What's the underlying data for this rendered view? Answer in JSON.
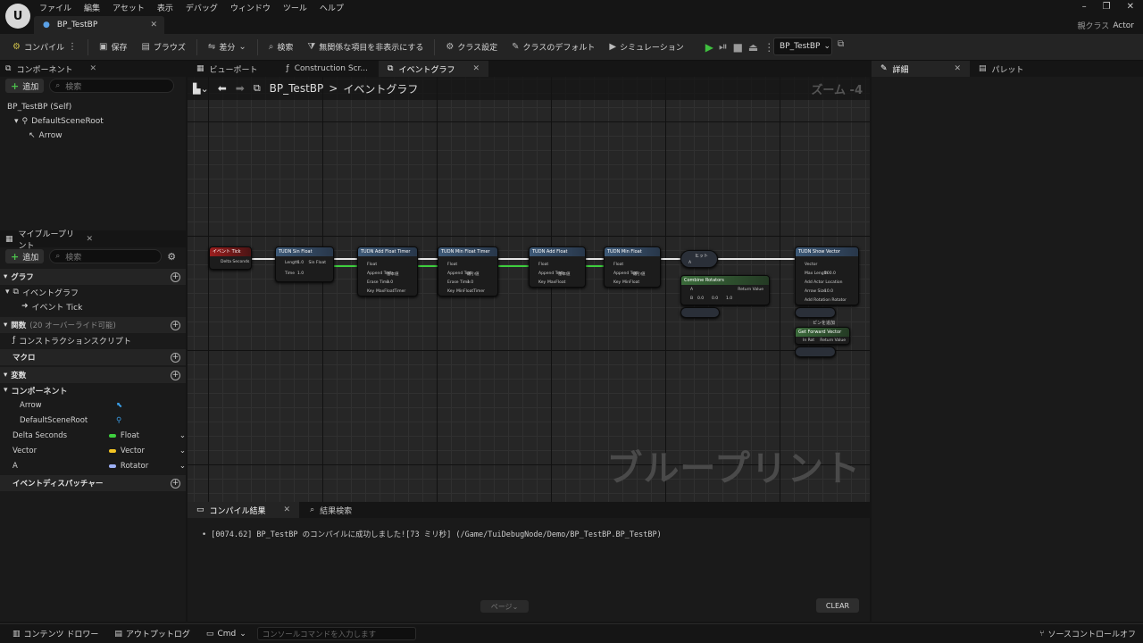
{
  "menu": [
    "ファイル",
    "編集",
    "アセット",
    "表示",
    "デバッグ",
    "ウィンドウ",
    "ツール",
    "ヘルプ"
  ],
  "doc_tab": "BP_TestBP",
  "parent_class": {
    "label": "親クラス",
    "value": "Actor"
  },
  "toolbar": {
    "compile": "コンパイル",
    "save": "保存",
    "browse": "ブラウズ",
    "diff": "差分",
    "find": "検索",
    "hide_unrelated": "無関係な項目を非表示にする",
    "class_settings": "クラス設定",
    "class_defaults": "クラスのデフォルト",
    "simulation": "シミュレーション",
    "debug_object": "BP_TestBP"
  },
  "components_panel": {
    "title": "コンポーネント",
    "add": "追加",
    "search_placeholder": "検索",
    "tree": [
      "BP_TestBP (Self)",
      "DefaultSceneRoot",
      "Arrow"
    ]
  },
  "my_blueprint": {
    "title": "マイブループリント",
    "add": "追加",
    "search_placeholder": "検索",
    "graphs": "グラフ",
    "event_graph": "イベントグラフ",
    "event_tick": "イベント Tick",
    "functions": "関数",
    "functions_sub": "(20 オーバーライド可能)",
    "construction_script": "コンストラクションスクリプト",
    "macros": "マクロ",
    "variables": "変数",
    "components": "コンポーネント",
    "comp_vars": [
      "Arrow",
      "DefaultSceneRoot"
    ],
    "vars": [
      {
        "name": "Delta Seconds",
        "type": "Float",
        "color": "#3ecf3e"
      },
      {
        "name": "Vector",
        "type": "Vector",
        "color": "#f3c423"
      },
      {
        "name": "A",
        "type": "Rotator",
        "color": "#9db0f5"
      }
    ],
    "dispatchers": "イベントディスパッチャー"
  },
  "graph_tabs": [
    "ビューポート",
    "Construction Scr...",
    "イベントグラフ"
  ],
  "graph": {
    "breadcrumb_bp": "BP_TestBP",
    "breadcrumb_sep": ">",
    "breadcrumb_graph": "イベントグラフ",
    "zoom": "ズーム -4",
    "watermark": "ブループリント"
  },
  "nodes": {
    "n1": {
      "title": "イベント Tick",
      "pin": "Delta Seconds"
    },
    "n2": {
      "title": "TUDN Sin Float",
      "pins": [
        "Length",
        "Time",
        "Sin Float"
      ],
      "vals": [
        "1.0",
        "1.0"
      ]
    },
    "n3": {
      "title": "TUDN Add Float Timer",
      "pins": [
        "Float",
        "Append Text",
        "Erase Time",
        "Key"
      ],
      "vals": [
        "基本値",
        "1.0",
        "MaxFloatTimer"
      ]
    },
    "n4": {
      "title": "TUDN Min Float Timer",
      "pins": [
        "Float",
        "Append Text",
        "Erase Time",
        "Key"
      ],
      "vals": [
        "最小値",
        "1.0",
        "MinFloatTimer"
      ]
    },
    "n5": {
      "title": "TUDN Add Float",
      "pins": [
        "Float",
        "Append Text",
        "Key"
      ],
      "vals": [
        "基本値",
        "MaxFloat"
      ]
    },
    "n6": {
      "title": "TUDN Min Float",
      "pins": [
        "Float",
        "Append Text",
        "Key"
      ],
      "vals": [
        "最小値",
        "MinFloat"
      ]
    },
    "n7": {
      "title": "ヒット",
      "pin": "A"
    },
    "n8": {
      "title": "Combine Rotators",
      "pins": [
        "A",
        "B",
        "Return Value"
      ],
      "vals": [
        "0.0",
        "0.0",
        "1.0"
      ]
    },
    "n9": {
      "title": "TUDN Show Vector",
      "pins": [
        "Vector",
        "Max Length",
        "Add Actor Location",
        "Arrow Size",
        "Add Rotation Rotator"
      ],
      "vals": [
        "100.0",
        "10.0"
      ]
    },
    "n10": {
      "title": "Get Forward Vector",
      "pins": [
        "In Rot",
        "Return Value"
      ]
    },
    "add_pin": "ピンを追加"
  },
  "log_tabs": [
    "コンパイル結果",
    "結果検索"
  ],
  "log": {
    "line": "[0074.62] BP_TestBP のコンパイルに成功しました![73 ミリ秒] (/Game/TuiDebugNode/Demo/BP_TestBP.BP_TestBP)",
    "page": "ページ",
    "clear": "CLEAR"
  },
  "right_tabs": [
    "詳細",
    "パレット"
  ],
  "status": {
    "content_drawer": "コンテンツ ドロワー",
    "output_log": "アウトプットログ",
    "cmd": "Cmd",
    "console_placeholder": "コンソールコマンドを入力します",
    "source_control": "ソースコントロールオフ"
  }
}
